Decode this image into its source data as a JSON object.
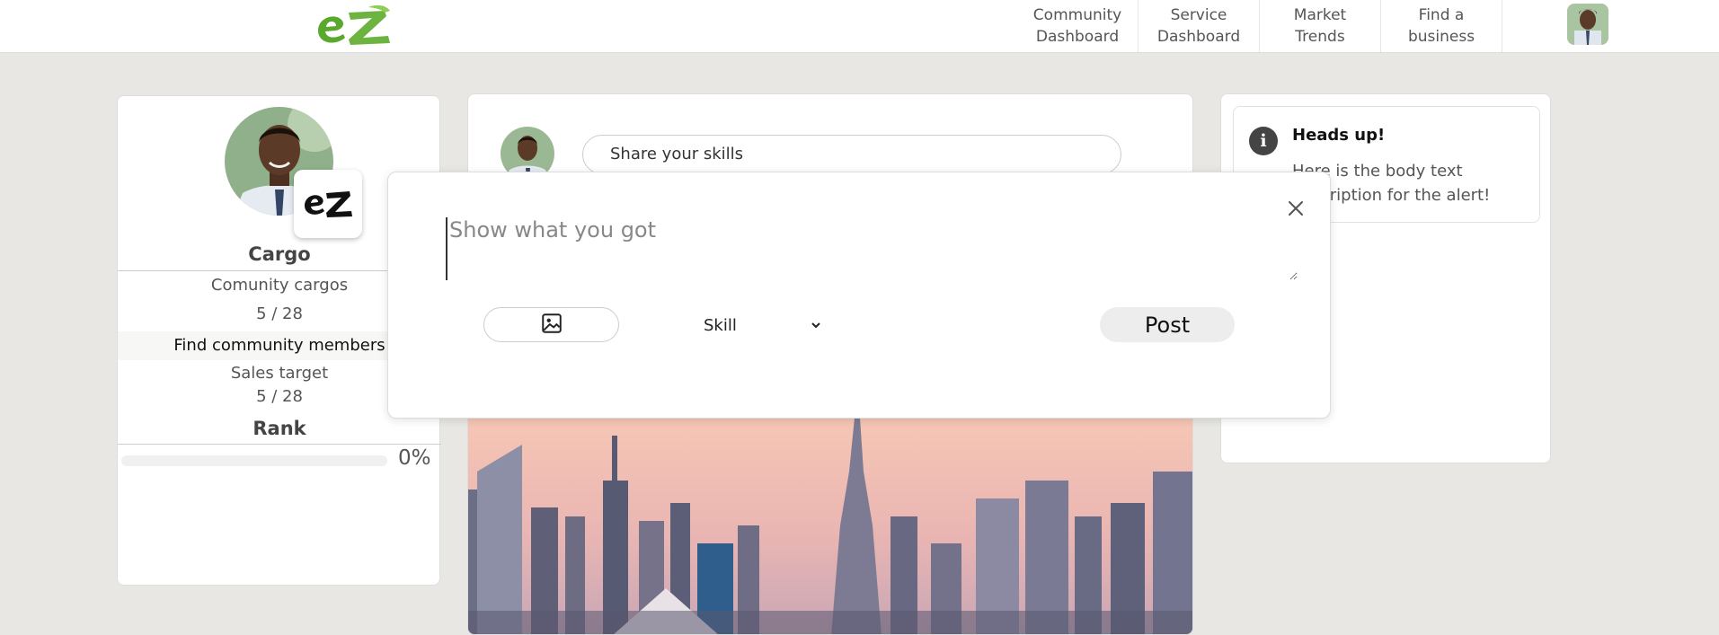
{
  "nav": {
    "items": [
      {
        "label": "Community\nDashboard"
      },
      {
        "label": "Service\nDashboard"
      },
      {
        "label": "Market\nTrends"
      },
      {
        "label": "Find a\nbusiness"
      }
    ]
  },
  "profile": {
    "name": "Cargo",
    "community_label": "Comunity cargos",
    "community_value": "5 / 28",
    "find_members_label": "Find community members",
    "sales_label": "Sales target",
    "sales_value": "5 / 28",
    "rank_label": "Rank",
    "rank_progress_percent": 0,
    "rank_progress_label": "0%"
  },
  "feed": {
    "share_placeholder": "Share your skills"
  },
  "alert": {
    "title": "Heads up!",
    "body": "Here is the body text description for the alert!",
    "icon": "info-icon"
  },
  "modal": {
    "text_placeholder": "Show what you got",
    "skill_selected": "Skill",
    "post_label": "Post"
  },
  "colors": {
    "brand_green": "#6cb33f",
    "page_bg": "#e8e7e3"
  }
}
